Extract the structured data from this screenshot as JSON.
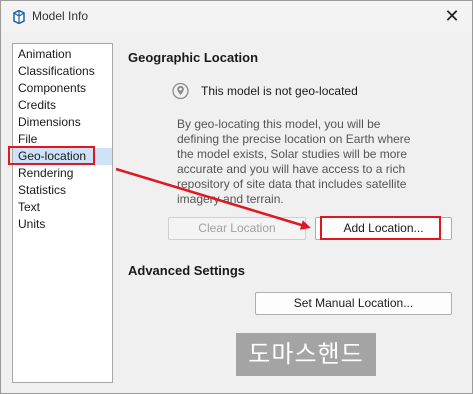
{
  "window": {
    "title": "Model Info",
    "close_glyph": "✕"
  },
  "sidebar": {
    "items": [
      {
        "label": "Animation",
        "selected": false
      },
      {
        "label": "Classifications",
        "selected": false
      },
      {
        "label": "Components",
        "selected": false
      },
      {
        "label": "Credits",
        "selected": false
      },
      {
        "label": "Dimensions",
        "selected": false
      },
      {
        "label": "File",
        "selected": false
      },
      {
        "label": "Geo-location",
        "selected": true
      },
      {
        "label": "Rendering",
        "selected": false
      },
      {
        "label": "Statistics",
        "selected": false
      },
      {
        "label": "Text",
        "selected": false
      },
      {
        "label": "Units",
        "selected": false
      }
    ]
  },
  "geo": {
    "section_title": "Geographic Location",
    "status": "This model is not geo-located",
    "description_lines": [
      "By geo-locating this model, you will be",
      "defining the precise location on Earth where",
      "the model exists, Solar studies will be more",
      "accurate and you will have access to a rich",
      "repository of site data that includes satellite",
      "imagery and terrain."
    ],
    "clear_button": "Clear Location",
    "add_button": "Add Location..."
  },
  "advanced": {
    "section_title": "Advanced Settings",
    "manual_button": "Set Manual Location..."
  },
  "watermark": "도마스핸드",
  "colors": {
    "highlight": "#e0171f",
    "selected_bg": "#cfe3f8"
  }
}
